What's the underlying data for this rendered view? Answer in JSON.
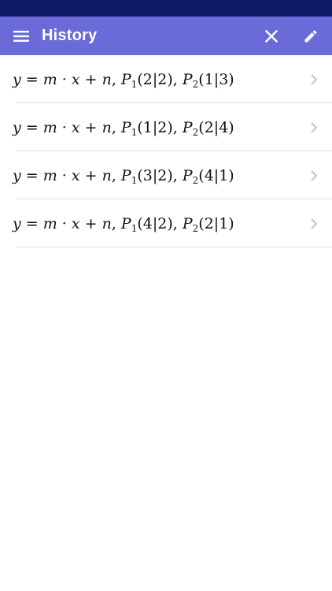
{
  "status_bar": {},
  "app_bar": {
    "title": "History",
    "icons": {
      "menu": "menu-icon",
      "close": "close-icon",
      "edit": "pencil-icon"
    }
  },
  "colors": {
    "status_bar": "#0d1b66",
    "app_bar": "#6a6ad8",
    "divider": "#e2e2e2",
    "chevron": "#c4c4c8"
  },
  "history": [
    {
      "equation": "y = m · x + n",
      "p1": "(2|2)",
      "p2": "(1|3)"
    },
    {
      "equation": "y = m · x + n",
      "p1": "(1|2)",
      "p2": "(2|4)"
    },
    {
      "equation": "y = m · x + n",
      "p1": "(3|2)",
      "p2": "(4|1)"
    },
    {
      "equation": "y = m · x + n",
      "p1": "(4|2)",
      "p2": "(2|1)"
    }
  ]
}
